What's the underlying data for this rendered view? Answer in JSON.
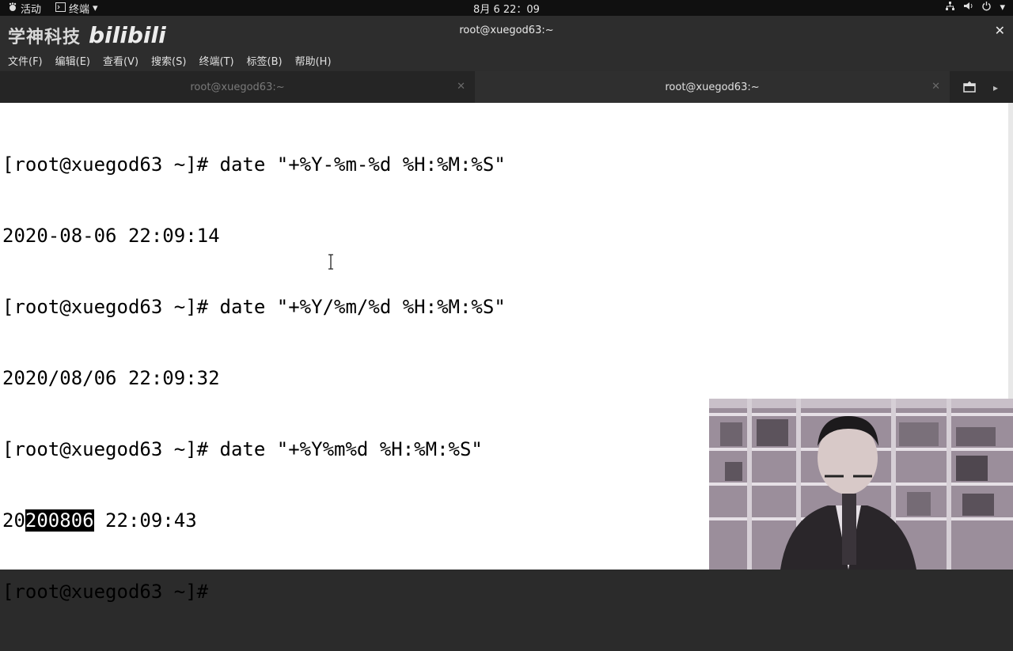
{
  "topbar": {
    "activities": "活动",
    "terminal_app": "终端",
    "clock": "8月 6  22：09"
  },
  "window": {
    "brand_cn": "学神科技",
    "brand_bili": "bilibili",
    "title": "root@xuegod63:~"
  },
  "menu": {
    "items": [
      "文件(F)",
      "编辑(E)",
      "查看(V)",
      "搜索(S)",
      "终端(T)",
      "标签(B)",
      "帮助(H)"
    ]
  },
  "tabs": [
    {
      "label": "root@xuegod63:~",
      "active": false
    },
    {
      "label": "root@xuegod63:~",
      "active": true
    }
  ],
  "terminal": {
    "lines": [
      "[root@xuegod63 ~]# date \"+%Y-%m-%d %H:%M:%S\"",
      "2020-08-06 22:09:14",
      "[root@xuegod63 ~]# date \"+%Y/%m/%d %H:%M:%S\"",
      "2020/08/06 22:09:32",
      "[root@xuegod63 ~]# date \"+%Y%m%d %H:%M:%S\""
    ],
    "line6_pre": "20",
    "line6_highlight": "200806",
    "line6_post": " 22:09:43",
    "prompt": "[root@xuegod63 ~]#"
  },
  "colors": {
    "terminal_bg": "#ffffff",
    "terminal_fg": "#000000",
    "chrome": "#2d2d2d",
    "topbar": "#101010"
  }
}
